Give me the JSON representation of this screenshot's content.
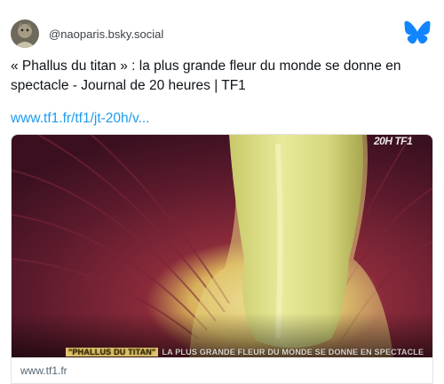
{
  "post": {
    "handle": "@naoparis.bsky.social",
    "text": "« Phallus du titan » : la plus grande fleur du monde se donne en spectacle - Journal de 20 heures | TF1",
    "link_text": "www.tf1.fr/tf1/jt-20h/v..."
  },
  "embed": {
    "caption_highlight": "\"PHALLUS DU TITAN\"",
    "caption_rest": "LA PLUS GRANDE FLEUR DU MONDE SE DONNE EN SPECTACLE",
    "channel_logo": "20H TF1",
    "domain": "www.tf1.fr"
  },
  "icons": {
    "service": "butterfly-icon",
    "avatar": "avatar-image"
  },
  "colors": {
    "link": "#1d9bf0",
    "butterfly": "#1185fe"
  }
}
